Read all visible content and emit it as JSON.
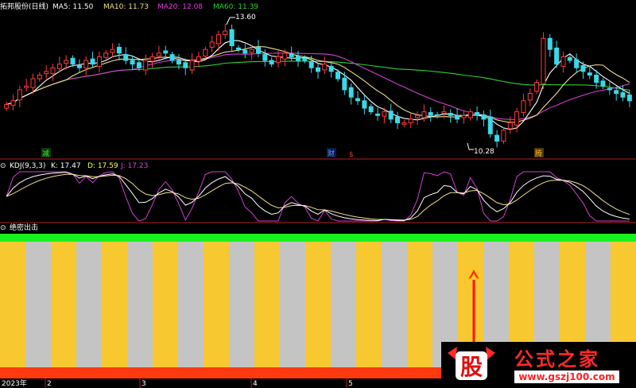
{
  "header": {
    "stock_title": "拓邦股份(日线)",
    "ma": [
      {
        "label": "MA5: 11.50",
        "color": "#ffffff"
      },
      {
        "label": "MA10: 11.73",
        "color": "#f0e08a"
      },
      {
        "label": "MA20: 12.08",
        "color": "#e040e0"
      },
      {
        "label": "MA60: 11.39",
        "color": "#30d030"
      }
    ]
  },
  "kdj": {
    "label": "KDJ(9,3,3)",
    "k": "K: 17.47",
    "d": "D: 17.59",
    "j": "J: 17.23"
  },
  "indicator": {
    "label": "绝密出击"
  },
  "price_annotations": {
    "high": "13.60",
    "low": "10.28"
  },
  "markers": [
    "减",
    "财",
    "$",
    "腾"
  ],
  "xaxis": {
    "year_label": "2023年",
    "month_ticks": [
      "2",
      "3",
      "4",
      "5"
    ]
  },
  "watermark": {
    "logo_char": "股",
    "title": "公式之家",
    "url": "www.gszj100.com"
  },
  "chart_data": {
    "type": "candlestick",
    "price_range": [
      10.0,
      13.9
    ],
    "closes": [
      11.4,
      11.5,
      11.8,
      11.9,
      12.1,
      12.2,
      12.3,
      12.4,
      12.5,
      12.6,
      12.5,
      12.4,
      12.6,
      12.5,
      12.7,
      12.8,
      12.9,
      12.8,
      12.6,
      12.5,
      12.4,
      12.6,
      12.7,
      12.8,
      12.8,
      12.6,
      12.5,
      12.4,
      12.6,
      12.7,
      12.9,
      13.1,
      13.3,
      13.4,
      13.0,
      12.9,
      12.8,
      12.9,
      12.8,
      12.6,
      12.5,
      12.7,
      12.8,
      12.7,
      12.6,
      12.6,
      12.4,
      12.3,
      12.5,
      12.3,
      12.1,
      11.8,
      11.6,
      11.5,
      11.3,
      11.2,
      11.1,
      11.2,
      11.0,
      10.9,
      10.9,
      11.0,
      11.1,
      11.2,
      11.1,
      11.1,
      11.2,
      11.1,
      11.0,
      11.1,
      11.2,
      11.1,
      11.0,
      10.6,
      10.4,
      10.7,
      10.9,
      11.2,
      11.5,
      11.7,
      12.0,
      13.2,
      12.9,
      12.5,
      12.7,
      12.6,
      12.4,
      12.3,
      12.2,
      12.0,
      11.9,
      11.8,
      11.7,
      11.6,
      11.5
    ],
    "ma5": 11.5,
    "ma10": 11.73,
    "ma20": 12.08,
    "ma60": 11.39,
    "kdj": {
      "k": 17.47,
      "d": 17.59,
      "j": 17.23,
      "range": [
        0,
        100
      ]
    },
    "signal_bands": [
      "y",
      "g",
      "y",
      "g",
      "y",
      "g",
      "y",
      "g",
      "y",
      "g",
      "y",
      "g",
      "y",
      "g",
      "y",
      "g",
      "y",
      "g",
      "y",
      "g",
      "y",
      "g",
      "y",
      "g",
      "y"
    ],
    "signal_colors": {
      "y": "#f8c830",
      "g": "#c4c4c4",
      "top": "#19f11e",
      "bottom": "#ff3a10"
    }
  }
}
